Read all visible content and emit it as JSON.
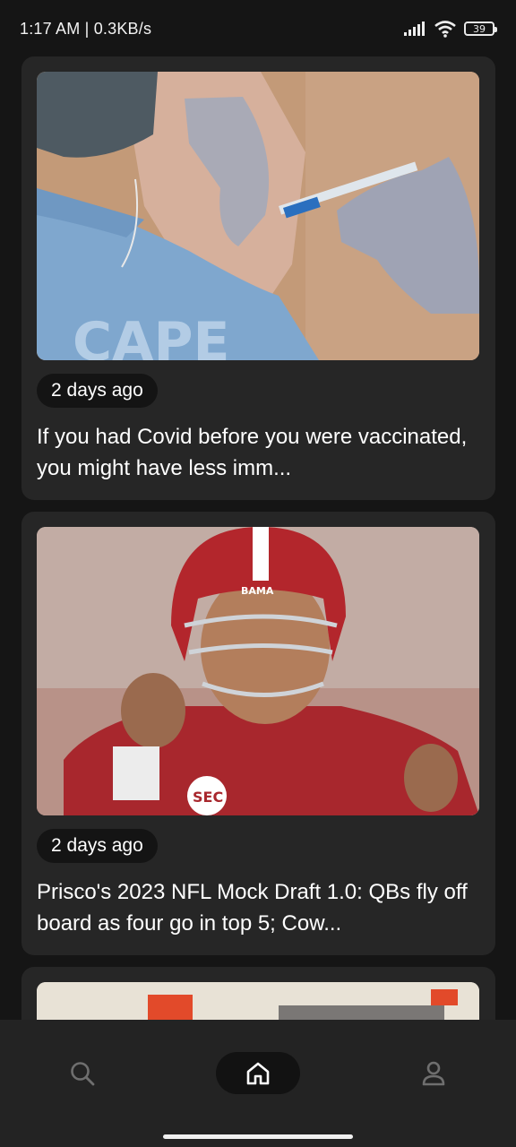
{
  "status_bar": {
    "time_speed": "1:17 AM | 0.3KB/s",
    "battery_level": "39",
    "icons": [
      "signal-icon",
      "wifi-icon",
      "battery-icon"
    ]
  },
  "feed": {
    "articles": [
      {
        "image": "vaccine-injection-photo",
        "time_ago": "2 days ago",
        "headline": "If you had Covid before you were vaccinated, you might have less imm..."
      },
      {
        "image": "alabama-quarterback-photo",
        "time_ago": "2 days ago",
        "headline": "Prisco's 2023 NFL Mock Draft 1.0: QBs fly off board as four go in top 5; Cow..."
      }
    ]
  },
  "nav": {
    "items": [
      "search-icon",
      "home-icon",
      "profile-icon"
    ],
    "active": "home"
  },
  "colors": {
    "background": "#151515",
    "card": "#262626",
    "pill": "#141414",
    "nav_bar": "#232323",
    "text": "#ffffff"
  }
}
